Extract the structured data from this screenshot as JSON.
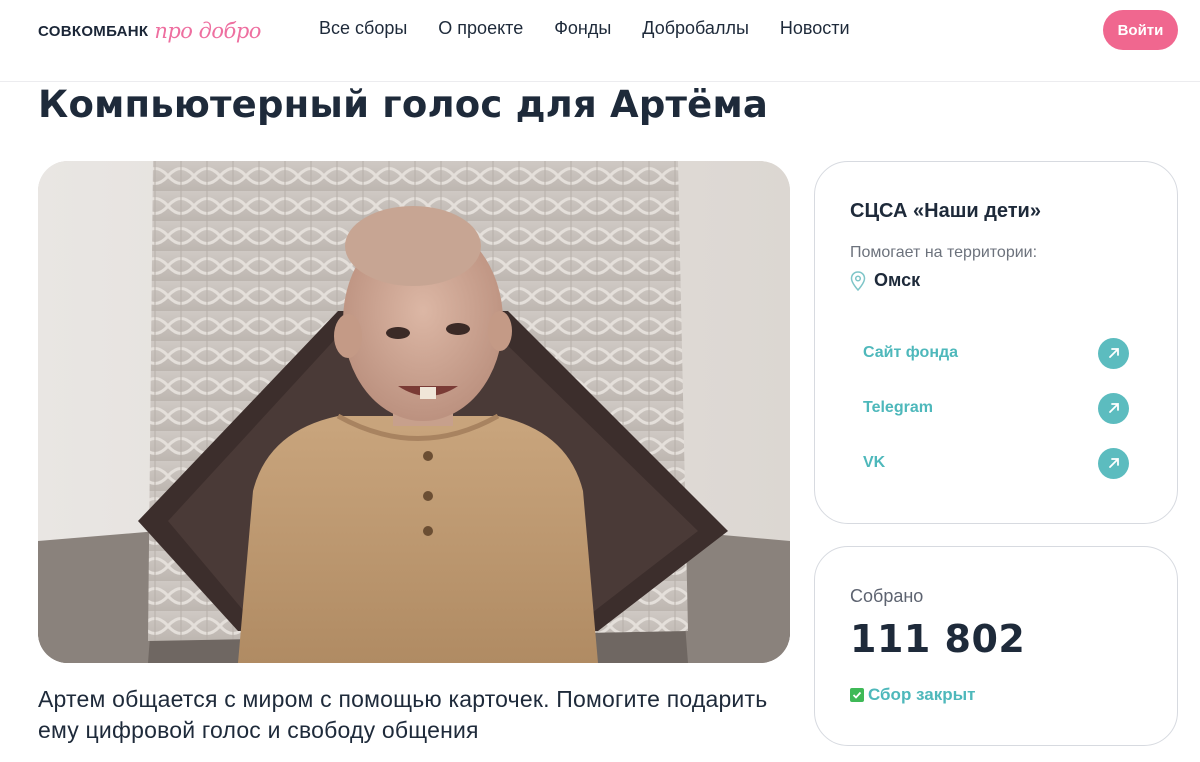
{
  "header": {
    "logo_bank": "СОВКОМБАНК",
    "logo_script": "про добро",
    "nav": [
      "Все сборы",
      "О проекте",
      "Фонды",
      "Добробаллы",
      "Новости"
    ],
    "login": "Войти"
  },
  "page": {
    "title": "Компьютерный голос для Артёма",
    "description": "Артем общается с миром с помощью карточек. Помогите подарить ему цифровой голос и свободу общения"
  },
  "fund": {
    "name": "СЦСА «Наши дети»",
    "helps_label": "Помогает на территории:",
    "city": "Омск",
    "links": [
      "Сайт фонда",
      "Telegram",
      "VK"
    ]
  },
  "collection": {
    "label": "Собрано",
    "amount": "111 802",
    "status": "Сбор закрыт"
  },
  "colors": {
    "accent_pink": "#f0678f",
    "accent_teal": "#5cbcbf",
    "text_dark": "#1e2a3a"
  }
}
